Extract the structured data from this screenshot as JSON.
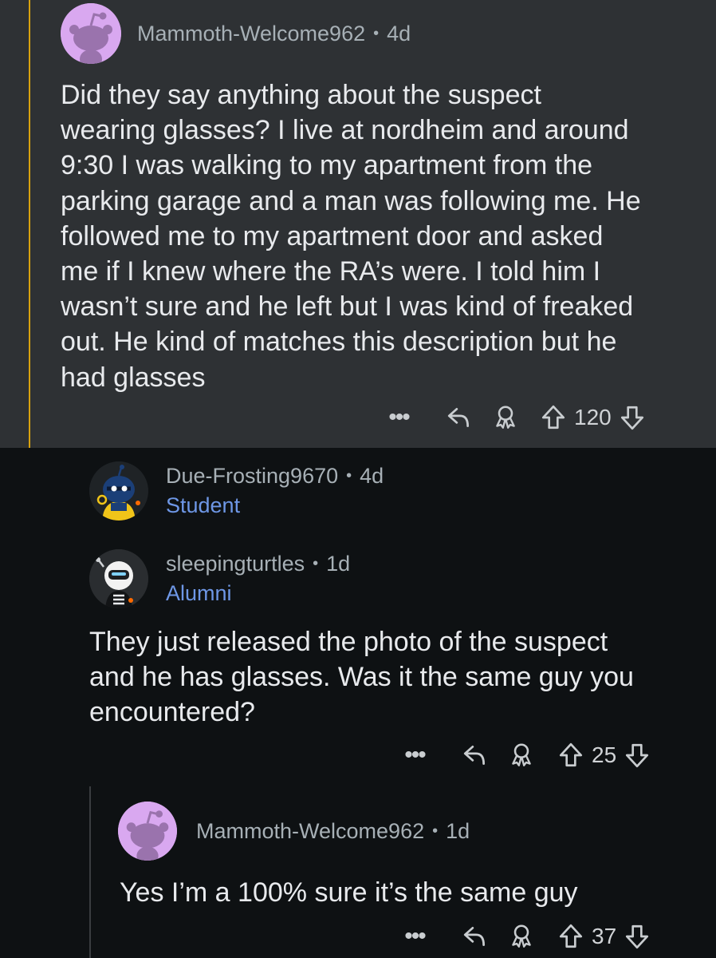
{
  "comments": [
    {
      "username": "Mammoth-Welcome962",
      "separator": "•",
      "age": "4d",
      "body_lines": [
        "Did they say anything about the suspect",
        "wearing glasses?  I live at nordheim and around",
        "9:30 I was walking to my apartment from the",
        "parking garage and a man was following me. He",
        "followed me to my apartment door and asked",
        "me if I knew where the RA’s were. I told him I",
        "wasn’t sure and he left but I was kind of freaked",
        "out. He kind of matches this description but he",
        "had glasses"
      ],
      "more": "•••",
      "score": "120",
      "highlighted": true,
      "highlight_color": "#d8a20f"
    },
    {
      "username": "Due-Frosting9670",
      "separator": "•",
      "age": "4d",
      "flair": "Student"
    },
    {
      "username": "sleepingturtles",
      "separator": "•",
      "age": "1d",
      "flair": "Alumni",
      "body_lines": [
        "They just released the photo of the suspect",
        "and he has glasses. Was it the same guy you",
        "encountered?"
      ],
      "more": "•••",
      "score": "25"
    },
    {
      "username": "Mammoth-Welcome962",
      "separator": "•",
      "age": "1d",
      "body_lines": [
        "Yes I’m a 100% sure it’s the same guy"
      ],
      "more": "•••",
      "score": "37"
    }
  ],
  "icons": {
    "reply": "reply-icon",
    "award": "award-icon",
    "upvote": "upvote-icon",
    "downvote": "downvote-icon",
    "more": "more-options-icon"
  },
  "colors": {
    "background": "#0e1113",
    "highlight_background": "#2e3134",
    "flair": "#6e97e6",
    "snoo_avatar": "#d9a8f0"
  }
}
